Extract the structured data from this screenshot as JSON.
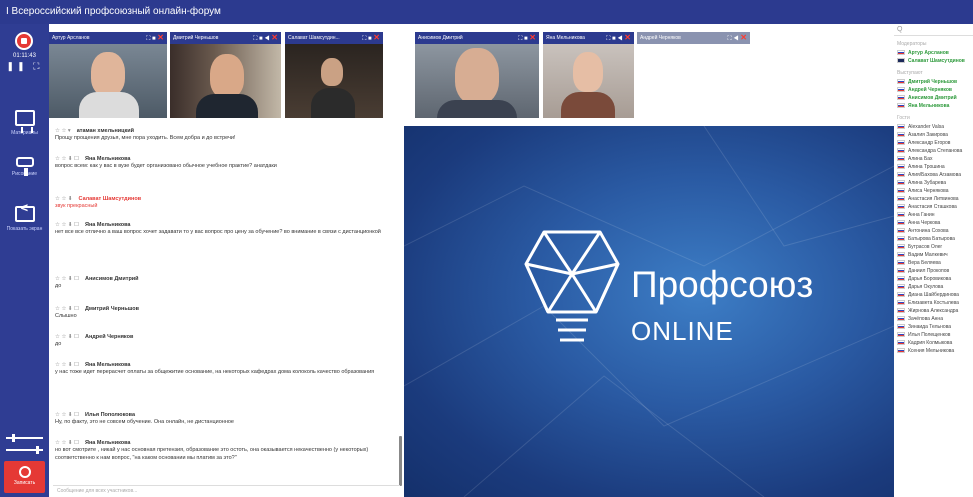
{
  "window": {
    "title": "I Всероссийский профсоюзный онлайн-форум"
  },
  "left_toolbar": {
    "timer": "01:11:43",
    "tools": [
      {
        "label": "Материалы",
        "icon": "presentation-icon"
      },
      {
        "label": "Рисование",
        "icon": "paint-roller-icon"
      },
      {
        "label": "Показать экран",
        "icon": "share-screen-icon"
      }
    ],
    "record_label": "Записать"
  },
  "video_tiles": [
    {
      "name": "Артур Арсланов"
    },
    {
      "name": "Дмитрий Черньшов"
    },
    {
      "name": "Салават Шамсутдин..."
    },
    {
      "name": "Анисимов Дмитрий"
    },
    {
      "name": "Яна Мельникова"
    },
    {
      "name": "Андрей Черняков"
    }
  ],
  "chat": {
    "messages": [
      {
        "author": "атаман хмельницкий",
        "text": "Прощу прощения друзья, мне пора уходить. Всем добра и до встречи!",
        "highlight": false
      },
      {
        "author": "Яна Мельникова",
        "text": "вопрос всем: как у вас в вузе будет организовано обычное учебное практие? анатдаки",
        "highlight": false
      },
      {
        "author": "Салават Шамсутдинов",
        "text": "звук прекрасный",
        "highlight": true
      },
      {
        "author": "Яна Мельникова",
        "text": "нет все все отлично а ваш вопрос хочет задавати то у вас вопрос про цену за обучение? во внимание в связи с дистанционкой",
        "highlight": false
      },
      {
        "author": "Анисимов Дмитрий",
        "text": "до",
        "highlight": false
      },
      {
        "author": "Дмитрий Черньшов",
        "text": "Слышно",
        "highlight": false
      },
      {
        "author": "Андрей Черняков",
        "text": "до",
        "highlight": false
      },
      {
        "author": "Яна Мельникова",
        "text": "у нас тоже идет перерасчет оплаты за общежитие основание, на некоторых кафедрах дома колоколь качество образования",
        "highlight": false
      },
      {
        "author": "Илья Пополюкова",
        "text": "Ну, по факту, это не совсем обучение. Она онлайн, не дистанционное",
        "highlight": false
      },
      {
        "author": "Яна Мельникова",
        "text": "но вот смотрите , никай у нас основная претензия, образование это остоть, она оказывается некачественно (у некоторых) соответственно к нам вопрос, \"на каком основании мы платим за это?\"",
        "highlight": false
      }
    ],
    "input_placeholder": "Сообщение для всех участников..."
  },
  "presentation": {
    "title": "Профсоюз",
    "subtitle": "ONLINE"
  },
  "participants": {
    "search_placeholder": "Q",
    "sections": [
      {
        "title": "Модераторы",
        "items": [
          "Артур Арсланов",
          "Салават Шамсутдинов"
        ]
      },
      {
        "title": "Выступают",
        "items": [
          "Дмитрий Черньшов",
          "Андрей Черняков",
          "Анисимов Дмитрий",
          "Яна Мельникова"
        ]
      },
      {
        "title": "Гости",
        "items": [
          "Alexander Valsa",
          "Азалия Закирова",
          "Александр Егоров",
          "Александра Степанова",
          "Алина Бах",
          "Алина Трошина",
          "Алия/Бахова Агзамова",
          "Алина Зубарева",
          "Алиса Чернякова",
          "Анастасия Литвинова",
          "Анастасия Сташкова",
          "Анна Ганин",
          "Анна Черкова",
          "Антонина Сохова",
          "Батырова Батырова",
          "Бутрасов Олег",
          "Вадим Малкевич",
          "Вера Беляева",
          "Даниил Прокопов",
          "Дарья Боровикова",
          "Дарья Окулова",
          "Диана Шайбердинова",
          "Елизавета Костылева",
          "Жирнова Александра",
          "Зачёпова Анна",
          "Зинаида Тельнова",
          "Илья Полещенков",
          "Кадрия Колмыкова",
          "Ксения Мельникова"
        ]
      }
    ]
  },
  "colors": {
    "brand": "#2c3a8f",
    "record": "#e53935",
    "moderator": "#2e9a3c"
  }
}
